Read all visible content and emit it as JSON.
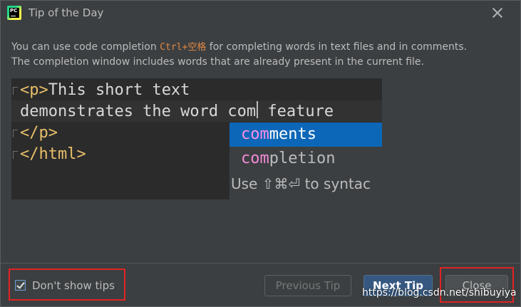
{
  "window": {
    "title": "Tip of the Day"
  },
  "tip": {
    "text_part1": "You can use code completion ",
    "shortcut": "Ctrl+空格",
    "text_part2": " for completing words in text files and in comments.",
    "text_line2": "The completion window includes words that are already present in the current file."
  },
  "code_example": {
    "partial_top": "    ·  ·        ·     ",
    "line1_tag": "<p>",
    "line1_text": "This short text",
    "line2_before_caret": "demonstrates the word com",
    "line2_after_caret": " feature",
    "line3_tag": "</p>",
    "line4_tag": "</html>"
  },
  "completion_popup": {
    "items": [
      {
        "match": "com",
        "rest": "ments",
        "selected": true
      },
      {
        "match": "com",
        "rest": "pletion",
        "selected": false
      }
    ],
    "hint": "Use ⇧⌘⏎ to syntac"
  },
  "footer": {
    "dont_show_label": "Don't show tips",
    "dont_show_checked": true,
    "previous_label": "Previous Tip",
    "next_label": "Next Tip",
    "close_label": "Close"
  },
  "watermark": "https://blog.csdn.net/shibuyiya",
  "colors": {
    "background": "#3c3f41",
    "editor_bg": "#2b2b2b",
    "selection": "#0d67b8",
    "annotation_red": "#e02424",
    "shortcut": "#e08844",
    "tag": "#e8bf6a"
  }
}
